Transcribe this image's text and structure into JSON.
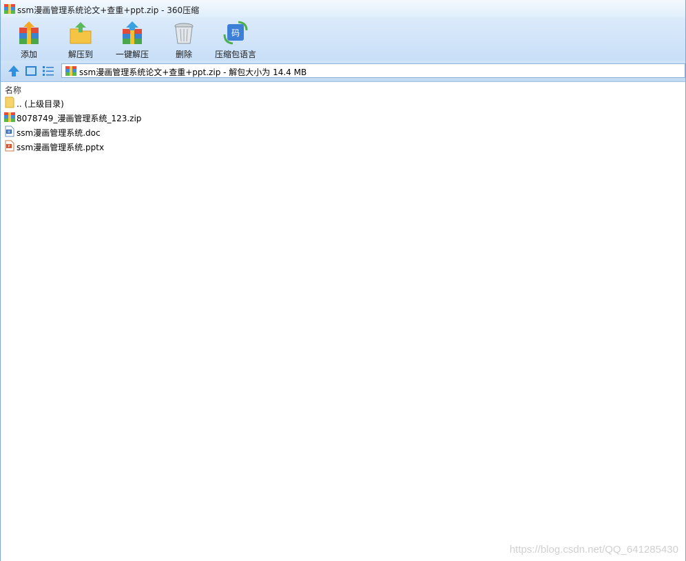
{
  "window": {
    "title": "ssm漫画管理系统论文+查重+ppt.zip - 360压缩"
  },
  "toolbar": {
    "buttons": [
      {
        "label": "添加",
        "icon": "add-archive-icon"
      },
      {
        "label": "解压到",
        "icon": "extract-to-folder-icon"
      },
      {
        "label": "一键解压",
        "icon": "one-click-extract-icon"
      },
      {
        "label": "删除",
        "icon": "trash-bin-icon"
      },
      {
        "label": "压缩包语言",
        "icon": "archive-encoding-icon"
      }
    ]
  },
  "navbar": {
    "path": "ssm漫画管理系统论文+查重+ppt.zip - 解包大小为 14.4 MB"
  },
  "list": {
    "column_name": "名称",
    "items": [
      {
        "name": ".. (上级目录)",
        "icon": "parent-folder-icon"
      },
      {
        "name": "8078749_漫画管理系统_123.zip",
        "icon": "zip-archive-icon"
      },
      {
        "name": "ssm漫画管理系统.doc",
        "icon": "word-document-icon"
      },
      {
        "name": "ssm漫画管理系统.pptx",
        "icon": "powerpoint-document-icon"
      }
    ]
  },
  "watermark": "https://blog.csdn.net/QQ_641285430"
}
